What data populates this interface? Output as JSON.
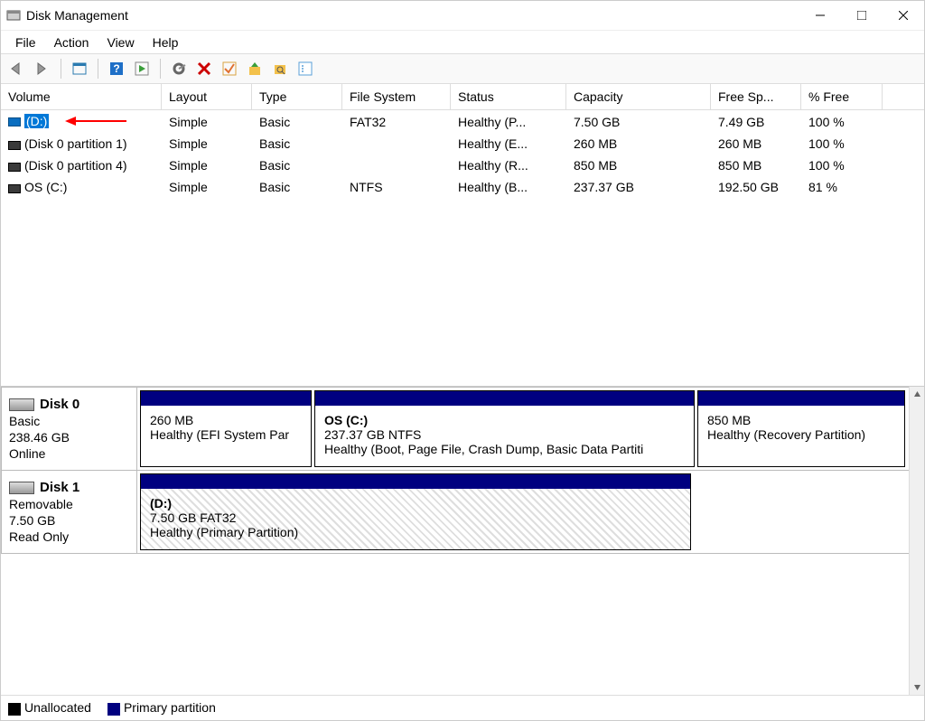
{
  "window": {
    "title": "Disk Management"
  },
  "menu": [
    "File",
    "Action",
    "View",
    "Help"
  ],
  "toolbar_icons": [
    "back-arrow-icon",
    "forward-arrow-icon",
    "show-hide-icon",
    "help-icon",
    "play-icon",
    "refresh-icon",
    "delete-x-icon",
    "check-icon",
    "up-arrow-icon",
    "search-icon",
    "properties-icon"
  ],
  "columns": {
    "volume": "Volume",
    "layout": "Layout",
    "type": "Type",
    "fs": "File System",
    "status": "Status",
    "capacity": "Capacity",
    "free": "Free Sp...",
    "pct": "% Free"
  },
  "rows": [
    {
      "icon": "blue",
      "name": "(D:)",
      "selected": true,
      "layout": "Simple",
      "type": "Basic",
      "fs": "FAT32",
      "status": "Healthy (P...",
      "capacity": "7.50 GB",
      "free": "7.49 GB",
      "pct": "100 %"
    },
    {
      "icon": "grey",
      "name": "(Disk 0 partition 1)",
      "layout": "Simple",
      "type": "Basic",
      "fs": "",
      "status": "Healthy (E...",
      "capacity": "260 MB",
      "free": "260 MB",
      "pct": "100 %"
    },
    {
      "icon": "grey",
      "name": "(Disk 0 partition 4)",
      "layout": "Simple",
      "type": "Basic",
      "fs": "",
      "status": "Healthy (R...",
      "capacity": "850 MB",
      "free": "850 MB",
      "pct": "100 %"
    },
    {
      "icon": "grey",
      "name": "OS (C:)",
      "layout": "Simple",
      "type": "Basic",
      "fs": "NTFS",
      "status": "Healthy (B...",
      "capacity": "237.37 GB",
      "free": "192.50 GB",
      "pct": "81 %"
    }
  ],
  "disks": [
    {
      "name": "Disk 0",
      "kind": "Basic",
      "size": "238.46 GB",
      "state": "Online",
      "partitions": [
        {
          "title": "",
          "size": "260 MB",
          "desc": "Healthy (EFI System Par",
          "flex": "0 0 190px"
        },
        {
          "title": "OS  (C:)",
          "size": "237.37 GB NTFS",
          "desc": "Healthy (Boot, Page File, Crash Dump, Basic Data Partiti",
          "flex": "1 1 auto"
        },
        {
          "title": "",
          "size": "850 MB",
          "desc": "Healthy (Recovery Partition)",
          "flex": "0 0 230px"
        }
      ]
    },
    {
      "name": "Disk 1",
      "kind": "Removable",
      "size": "7.50 GB",
      "state": "Read Only",
      "partitions": [
        {
          "title": "  (D:)",
          "size": "7.50 GB FAT32",
          "desc": "Healthy (Primary Partition)",
          "hatch": true,
          "flex": "0 0 610px"
        }
      ]
    }
  ],
  "legend": {
    "unalloc": "Unallocated",
    "primary": "Primary partition"
  }
}
